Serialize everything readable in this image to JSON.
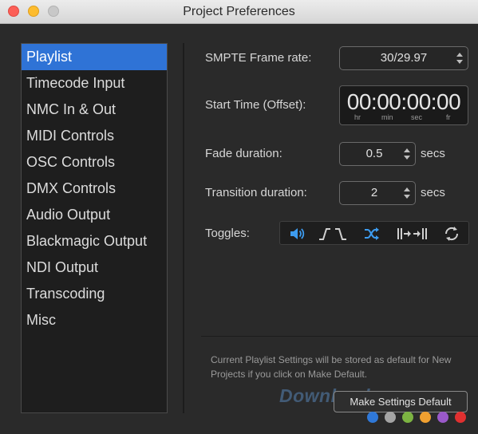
{
  "window": {
    "title": "Project Preferences"
  },
  "sidebar": {
    "items": [
      {
        "label": "Playlist",
        "selected": true
      },
      {
        "label": "Timecode Input"
      },
      {
        "label": "NMC In & Out"
      },
      {
        "label": "MIDI Controls"
      },
      {
        "label": "OSC Controls"
      },
      {
        "label": "DMX Controls"
      },
      {
        "label": "Audio Output"
      },
      {
        "label": "Blackmagic Output"
      },
      {
        "label": "NDI Output"
      },
      {
        "label": "Transcoding"
      },
      {
        "label": "Misc"
      }
    ]
  },
  "settings": {
    "smpte": {
      "label": "SMPTE Frame rate:",
      "value": "30/29.97"
    },
    "start_time": {
      "label": "Start Time (Offset):",
      "value": "00:00:00:00",
      "units": [
        "hr",
        "min",
        "sec",
        "fr"
      ]
    },
    "fade": {
      "label": "Fade duration:",
      "value": "0.5",
      "unit": "secs"
    },
    "transition": {
      "label": "Transition duration:",
      "value": "2",
      "unit": "secs"
    },
    "toggles": {
      "label": "Toggles:",
      "icons": [
        "speaker-icon",
        "fade-in-out-icon",
        "shuffle-icon",
        "skip-icon",
        "repeat-icon"
      ],
      "active_color": "#3d9cf0",
      "inactive_color": "#d0d0d0"
    }
  },
  "footer": {
    "note": "Current Playlist Settings will be stored as default for New Projects if you click on Make Default.",
    "make_default_label": "Make Settings Default"
  },
  "watermark": {
    "text": "Download.vn"
  },
  "colors": {
    "accent": "#2f73d6",
    "dots": [
      "#2f78d8",
      "#a4a4a4",
      "#7cb342",
      "#f0a030",
      "#9a59c9",
      "#e03030"
    ]
  }
}
